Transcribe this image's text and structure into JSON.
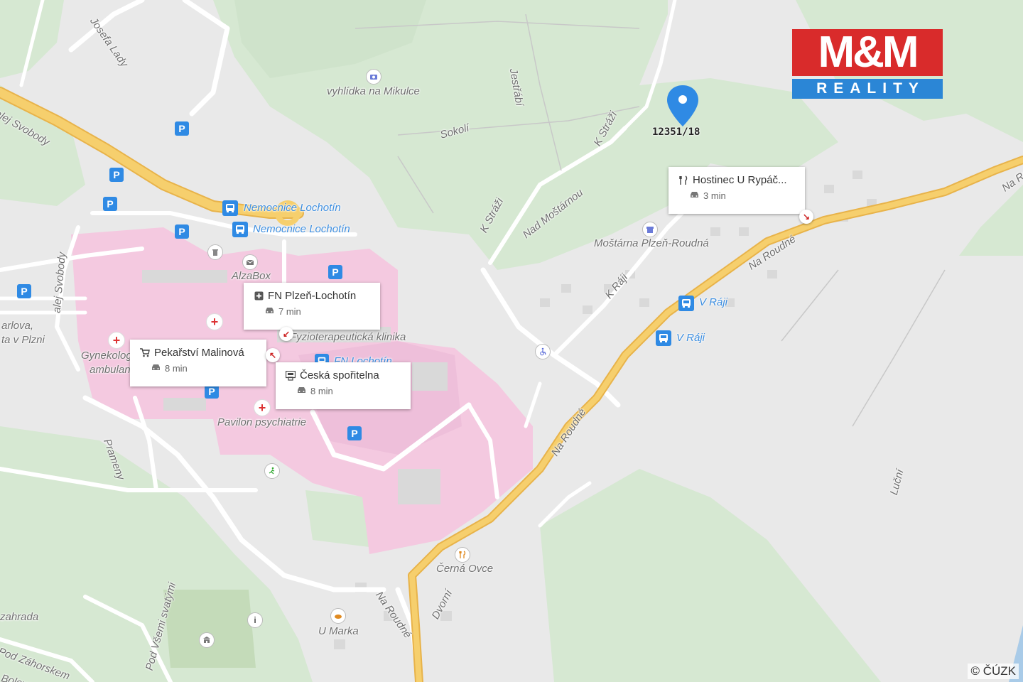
{
  "map": {
    "colors": {
      "background": "#e9e9e9",
      "green": "#d6e8d2",
      "hospital": "#f4c9e0",
      "road_white": "#ffffff",
      "road_major": "#f2c15c",
      "accent_blue": "#2f8ae4",
      "pin_blue": "#2f8ae4"
    },
    "street_labels": [
      "alej Svobody",
      "Sokolí",
      "Jestřábí",
      "K Stráži",
      "K Stráži",
      "Nad Moštárnou",
      "K Ráji",
      "Na Roudné",
      "Na Roudné",
      "Na Roudné",
      "Luční",
      "Prameny",
      "alej Svobody",
      "Pod Všemi svatými",
      "Dvorní",
      "Pod Záhorskem",
      "Josefa Lady",
      "zahrada",
      "Bolevecká"
    ],
    "poi_labels": [
      "vyhlídka na Mikulce",
      "AlzaBox",
      "Moštárna Plzeň-Roudná",
      "Pavilon psychiatrie",
      "Černá Ovce",
      "U Marka",
      "Gynekolog",
      "ambulan",
      "arlova,",
      "ta v Plzni",
      "Fyzioterapeutická klinika"
    ],
    "transit_labels": [
      "Nemocnice Lochotín",
      "Nemocnice Lochotín",
      "V Ráji",
      "V Ráji",
      "FN Lochotín"
    ],
    "pin": {
      "label": "12351/18",
      "icon": "map-pin-icon"
    },
    "cards": [
      {
        "name": "Hostinec U Rypáč...",
        "time": "3 min",
        "icon": "restaurant-icon"
      },
      {
        "name": "FN Plzeň-Lochotín",
        "time": "7 min",
        "icon": "hospital-icon"
      },
      {
        "name": "Pekařství Malinová",
        "time": "8 min",
        "icon": "shopping-cart-icon"
      },
      {
        "name": "Česká spořitelna",
        "time": "8 min",
        "icon": "atm-icon"
      }
    ],
    "icon_glyphs": {
      "parking": "P",
      "medical": "+",
      "info": "i"
    }
  },
  "logo": {
    "top": "M&M",
    "bottom": "REALITY"
  },
  "copyright": "© ČÚZK"
}
